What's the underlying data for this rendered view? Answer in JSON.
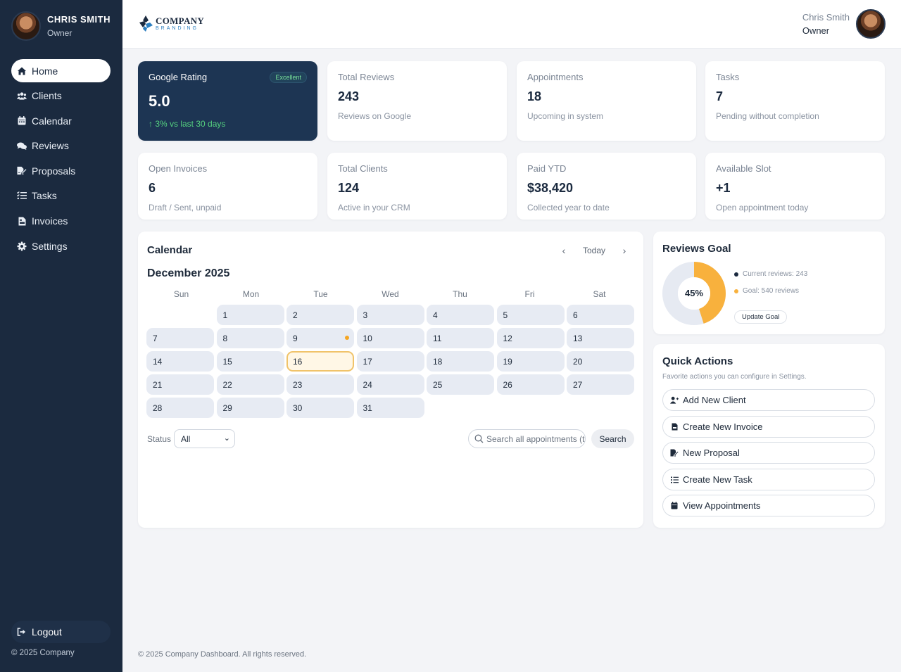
{
  "sidebar": {
    "user": {
      "name": "CHRIS SMITH",
      "role": "Owner"
    },
    "nav": [
      {
        "label": "Home",
        "icon": "home-icon",
        "active": true
      },
      {
        "label": "Clients",
        "icon": "users-icon"
      },
      {
        "label": "Calendar",
        "icon": "calendar-icon"
      },
      {
        "label": "Reviews",
        "icon": "comments-icon"
      },
      {
        "label": "Proposals",
        "icon": "file-signature-icon"
      },
      {
        "label": "Tasks",
        "icon": "tasks-icon"
      },
      {
        "label": "Invoices",
        "icon": "invoice-icon"
      },
      {
        "label": "Settings",
        "icon": "gear-icon"
      }
    ],
    "logout": "Logout",
    "copyright": "© 2025 Company"
  },
  "header": {
    "logo": {
      "company": "COMPANY",
      "branding": "BRANDING"
    },
    "user": {
      "name": "Chris Smith",
      "role": "Owner"
    }
  },
  "stats": [
    {
      "label": "Google Rating",
      "value": "5.0",
      "sub": "↑ 3% vs last 30 days",
      "badge": "Excellent"
    },
    {
      "label": "Total Reviews",
      "value": "243",
      "sub": "Reviews on Google"
    },
    {
      "label": "Appointments",
      "value": "18",
      "sub": "Upcoming in system"
    },
    {
      "label": "Tasks",
      "value": "7",
      "sub": "Pending without completion"
    },
    {
      "label": "Open Invoices",
      "value": "6",
      "sub": "Draft / Sent, unpaid"
    },
    {
      "label": "Total Clients",
      "value": "124",
      "sub": "Active in your CRM"
    },
    {
      "label": "Paid YTD",
      "value": "$38,420",
      "sub": "Collected year to date"
    },
    {
      "label": "Available Slot",
      "value": "+1",
      "sub": "Open appointment today"
    }
  ],
  "calendar": {
    "title": "Calendar",
    "today_label": "Today",
    "month": "December 2025",
    "weekdays": [
      "Sun",
      "Mon",
      "Tue",
      "Wed",
      "Thu",
      "Fri",
      "Sat"
    ],
    "first_weekday_index": 1,
    "days_in_month": 31,
    "today": 16,
    "event_days": [
      9
    ],
    "status_label": "Status",
    "status_value": "All",
    "search_placeholder": "Search all appointments (t",
    "search_button": "Search"
  },
  "reviews_goal": {
    "title": "Reviews Goal",
    "percent": 45,
    "percent_label": "45%",
    "current": "Current reviews: 243",
    "goal": "Goal: 540 reviews",
    "button": "Update Goal",
    "colors": {
      "progress": "#f8b13d",
      "track": "#e6eaf2",
      "current_dot": "#1b2a3f"
    }
  },
  "quick_actions": {
    "title": "Quick Actions",
    "subtitle": "Favorite actions you can configure in Settings.",
    "items": [
      {
        "label": "Add New Client",
        "icon": "user-plus-icon"
      },
      {
        "label": "Create New Invoice",
        "icon": "invoice-icon"
      },
      {
        "label": "New Proposal",
        "icon": "file-signature-icon"
      },
      {
        "label": "Create New Task",
        "icon": "tasks-icon"
      },
      {
        "label": "View Appointments",
        "icon": "calendar-icon"
      }
    ]
  },
  "footer": "© 2025 Company Dashboard. All rights reserved."
}
